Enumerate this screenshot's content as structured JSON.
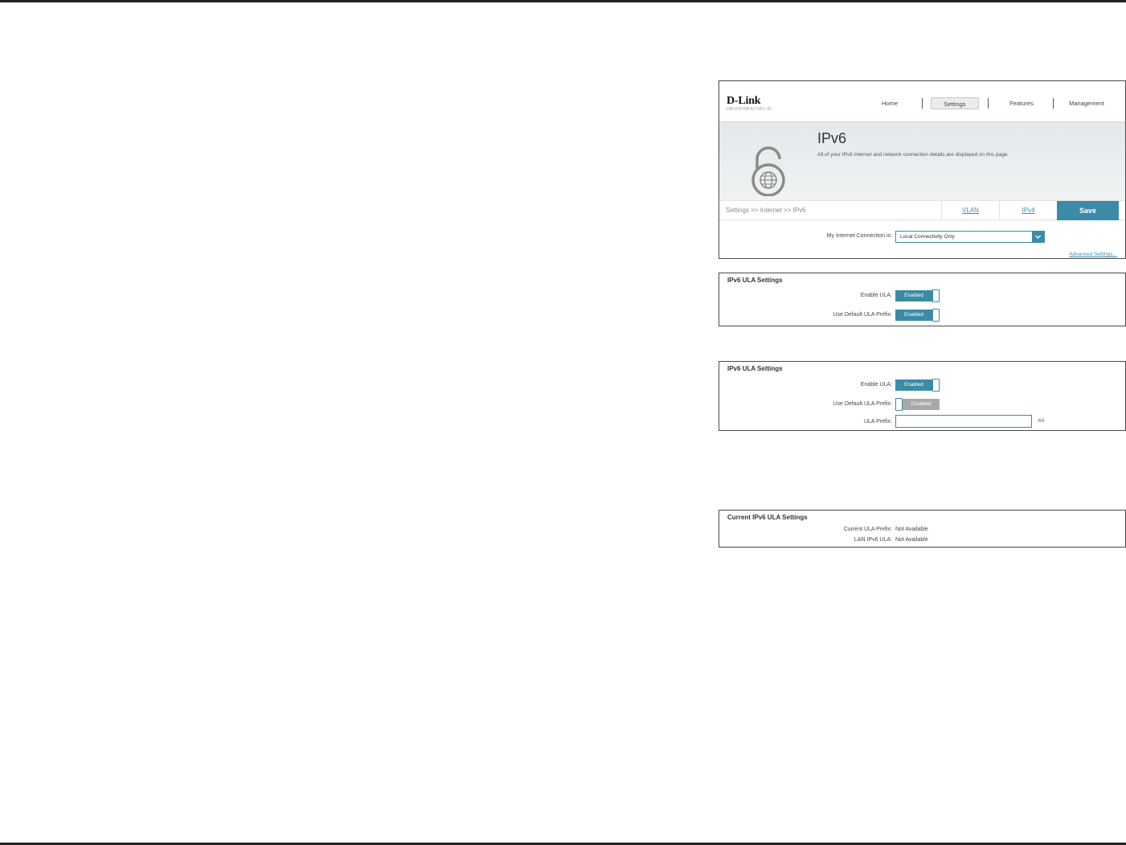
{
  "header": {
    "logo": "D-Link",
    "model": "DIR-878 HW:A1 FW:1.00",
    "nav": [
      "Home",
      "Settings",
      "Features",
      "Management"
    ]
  },
  "banner": {
    "title": "IPv6",
    "description": "All of your IPv6 Internet and network connection details are displayed on this page."
  },
  "toolbar": {
    "breadcrumb": "Settings >> Internet >> IPv6",
    "vlan_label": "VLAN",
    "ipv4_label": "IPv4",
    "save_label": "Save"
  },
  "connection": {
    "label": "My Internet Connection is:",
    "value": "Local Connectivity Only",
    "advanced_link": "Advanced Settings..."
  },
  "ula_box_1": {
    "title": "IPv6 ULA Settings",
    "enable_label": "Enable ULA:",
    "enable_value": "Enabled",
    "default_prefix_label": "Use Default ULA Prefix:",
    "default_prefix_value": "Enabled"
  },
  "ula_box_2": {
    "title": "IPv6 ULA Settings",
    "enable_label": "Enable ULA:",
    "enable_value": "Enabled",
    "default_prefix_label": "Use Default ULA Prefix:",
    "default_prefix_value": "Disabled",
    "prefix_label": "ULA Prefix:",
    "prefix_value": "",
    "prefix_suffix": "/64"
  },
  "current_box": {
    "title": "Current IPv6 ULA Settings",
    "current_prefix_label": "Current ULA Prefix:",
    "current_prefix_value": "Not Available",
    "lan_ula_label": "LAN IPv6 ULA:",
    "lan_ula_value": "Not Available"
  },
  "colors": {
    "accent": "#3b8ba6",
    "disabled": "#a8a8a8",
    "link": "#3b8fb0"
  },
  "icons": {
    "banner_icon": "unlocked-padlock-globe-icon",
    "dropdown_icon": "chevron-down-icon"
  }
}
